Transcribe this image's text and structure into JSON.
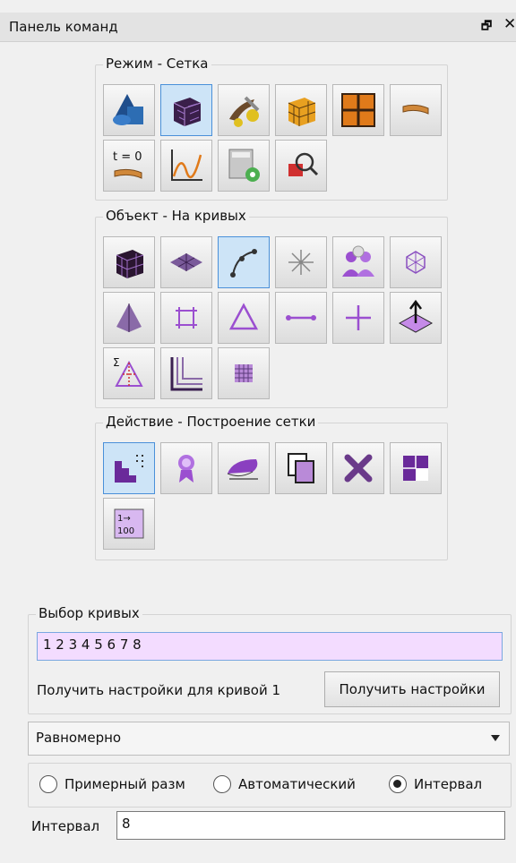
{
  "panel": {
    "title": "Панель команд",
    "float_icon": "restore-icon",
    "close_icon": "close-icon"
  },
  "groups": {
    "mode": {
      "label": "Режим - Сетка"
    },
    "object": {
      "label": "Объект - На кривых"
    },
    "action": {
      "label": "Действие - Построение сетки"
    }
  },
  "mode_tools": [
    {
      "icon": "geometry-shapes-icon"
    },
    {
      "icon": "mesh-cube-icon"
    },
    {
      "icon": "mesh-tools-icon"
    },
    {
      "icon": "structured-block-icon"
    },
    {
      "icon": "grid-block-icon"
    },
    {
      "icon": "mesh-curve-icon"
    },
    {
      "icon": "time-step-icon",
      "text": "t = 0"
    },
    {
      "icon": "graph-curve-icon"
    },
    {
      "icon": "calculator-gear-icon"
    },
    {
      "icon": "zoom-inspect-icon"
    }
  ],
  "object_tools": [
    {
      "icon": "volume-mesh-icon"
    },
    {
      "icon": "surface-mesh-icon"
    },
    {
      "icon": "curve-mesh-icon"
    },
    {
      "icon": "node-icon"
    },
    {
      "icon": "parts-icon"
    },
    {
      "icon": "topology-icon"
    },
    {
      "icon": "tetra-mesh-icon"
    },
    {
      "icon": "quad-edit-icon"
    },
    {
      "icon": "triangle-edit-icon"
    },
    {
      "icon": "line-edit-icon"
    },
    {
      "icon": "point-edit-icon"
    },
    {
      "icon": "vector-icon"
    },
    {
      "icon": "sum-triangle-icon"
    },
    {
      "icon": "blocking-icon"
    },
    {
      "icon": "grid-icon"
    }
  ],
  "action_tools": [
    {
      "icon": "mesh-build-icon"
    },
    {
      "icon": "award-icon"
    },
    {
      "icon": "smooth-icon"
    },
    {
      "icon": "copy-icon"
    },
    {
      "icon": "delete-x-icon"
    },
    {
      "icon": "grid-replace-icon"
    },
    {
      "icon": "numbering-icon",
      "text": "1→100"
    }
  ],
  "curve_select": {
    "label": "Выбор кривых",
    "value": "1 2 3 4 5 6 7 8",
    "get_settings_label": "Получить настройки для кривой 1",
    "get_settings_button": "Получить настройки"
  },
  "distribution": {
    "selected": "Равномерно"
  },
  "mode_radio": {
    "options": [
      "Примерный разм",
      "Автоматический",
      "Интервал"
    ],
    "selected_index": 2
  },
  "interval": {
    "label": "Интервал",
    "value": "8"
  },
  "colors": {
    "accent_purple": "#9b59d0",
    "active_button": "#cde4f7",
    "input_highlight": "#f3dcff"
  }
}
